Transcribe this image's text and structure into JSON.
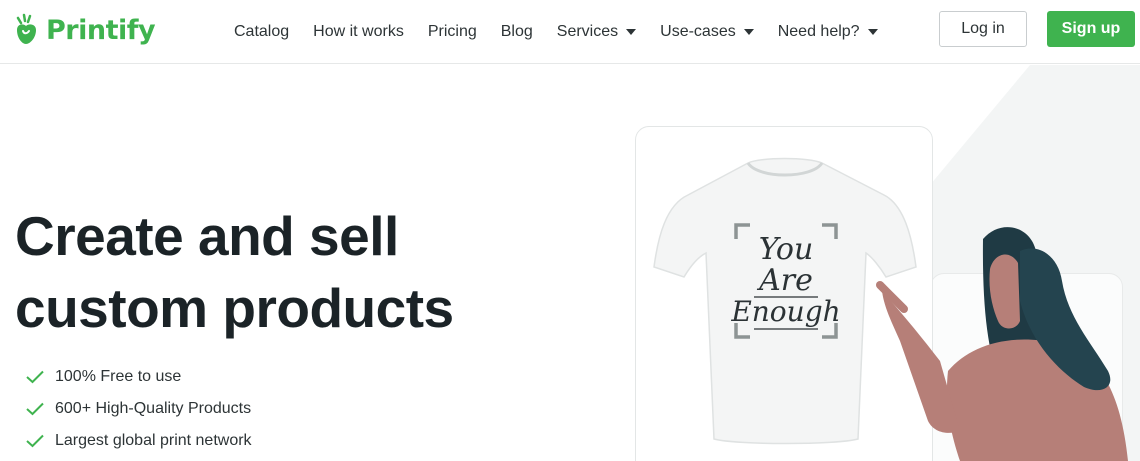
{
  "brand": {
    "name": "Printify",
    "color": "#3fb34f"
  },
  "nav": {
    "items": [
      {
        "label": "Catalog",
        "dropdown": false
      },
      {
        "label": "How it works",
        "dropdown": false
      },
      {
        "label": "Pricing",
        "dropdown": false
      },
      {
        "label": "Blog",
        "dropdown": false
      },
      {
        "label": "Services",
        "dropdown": true
      },
      {
        "label": "Use-cases",
        "dropdown": true
      },
      {
        "label": "Need help?",
        "dropdown": true
      }
    ]
  },
  "auth": {
    "login_label": "Log in",
    "signup_label": "Sign up"
  },
  "hero": {
    "headline_line1": "Create and sell",
    "headline_line2": "custom products",
    "features": [
      "100% Free to use",
      "600+ High-Quality Products",
      "Largest global print network"
    ]
  },
  "product_card": {
    "shirt_text_1": "You",
    "shirt_text_2": "Are",
    "shirt_text_3": "Enough"
  },
  "colors": {
    "accent": "#3fb34f",
    "text": "#1b2327",
    "skin": "#b67f78",
    "hair": "#1f3a44"
  }
}
